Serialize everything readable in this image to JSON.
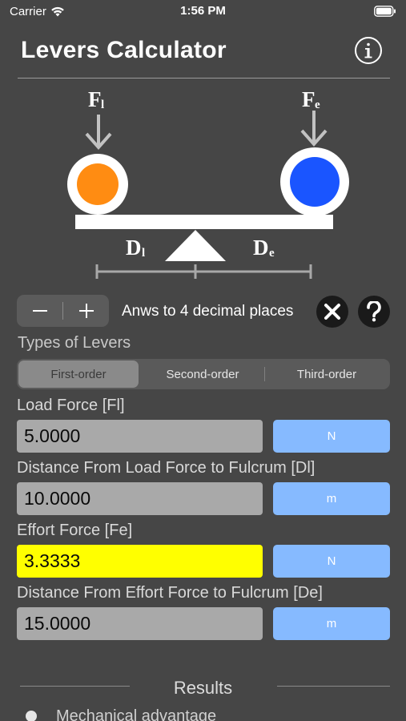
{
  "status_bar": {
    "carrier": "Carrier",
    "time": "1:56 PM"
  },
  "header": {
    "title": "Levers Calculator"
  },
  "diagram": {
    "load_force_label": "F",
    "load_force_sub": "l",
    "effort_force_label": "F",
    "effort_force_sub": "e",
    "load_distance_label": "D",
    "load_distance_sub": "l",
    "effort_distance_label": "D",
    "effort_distance_sub": "e",
    "load_color": "#ff8c12",
    "effort_color": "#1a55ff"
  },
  "precision": {
    "minus_label": "−",
    "plus_label": "+",
    "label": "Anws to 4 decimal places"
  },
  "lever_types": {
    "label": "Types of Levers",
    "options": [
      "First-order",
      "Second-order",
      "Third-order"
    ],
    "selected": "First-order"
  },
  "fields": [
    {
      "label": "Load Force [Fl]",
      "value": "5.0000",
      "unit": "N",
      "highlighted": false
    },
    {
      "label": "Distance From Load Force to Fulcrum [Dl]",
      "value": "10.0000",
      "unit": "m",
      "highlighted": false
    },
    {
      "label": "Effort Force [Fe]",
      "value": "3.3333",
      "unit": "N",
      "highlighted": true
    },
    {
      "label": "Distance From Effort Force to Fulcrum [De]",
      "value": "15.0000",
      "unit": "m",
      "highlighted": false
    }
  ],
  "results": {
    "title": "Results",
    "items": [
      "Mechanical advantage"
    ]
  },
  "colors": {
    "background": "#464646",
    "highlight": "#ffff00",
    "unit_button": "#86baff"
  }
}
